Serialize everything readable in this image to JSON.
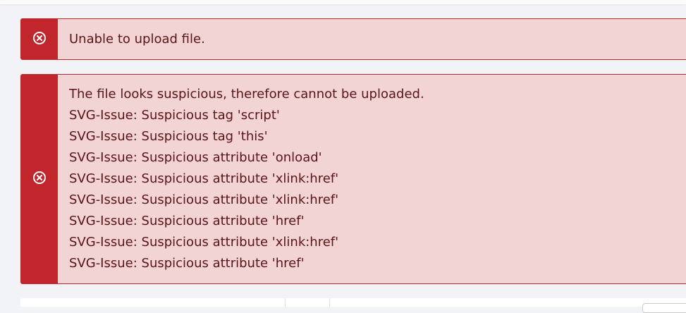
{
  "alerts": {
    "upload_error": {
      "icon": "error-circle-x-icon",
      "message": "Unable to upload file."
    },
    "suspicious_file": {
      "icon": "error-circle-x-icon",
      "lines": [
        "The file looks suspicious, therefore cannot be uploaded.",
        "SVG-Issue: Suspicious tag 'script'",
        "SVG-Issue: Suspicious tag 'this'",
        "SVG-Issue: Suspicious attribute 'onload'",
        "SVG-Issue: Suspicious attribute 'xlink:href'",
        "SVG-Issue: Suspicious attribute 'xlink:href'",
        "SVG-Issue: Suspicious attribute 'href'",
        "SVG-Issue: Suspicious attribute 'xlink:href'",
        "SVG-Issue: Suspicious attribute 'href'"
      ]
    }
  },
  "colors": {
    "alert_accent": "#c0262b",
    "alert_background": "#f2d4d5",
    "alert_text": "#5a1418"
  }
}
